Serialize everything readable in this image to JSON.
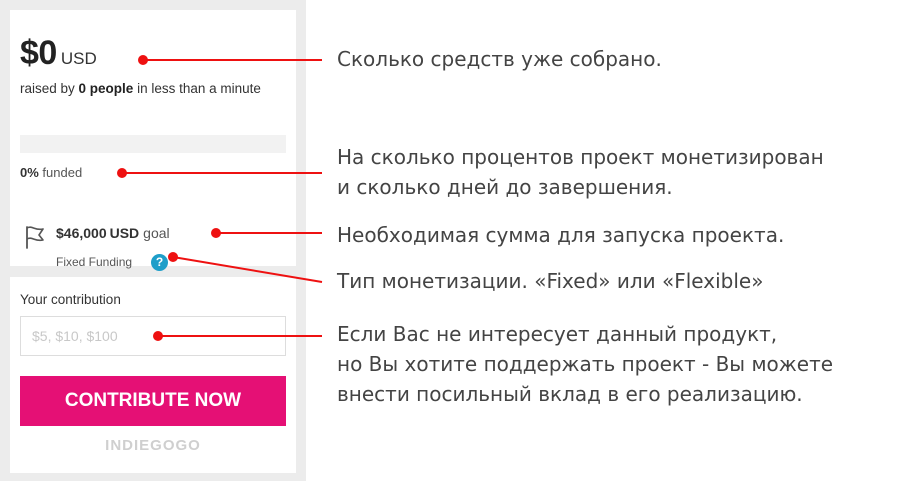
{
  "campaign": {
    "amount": "$0",
    "currency": "USD",
    "raised_prefix": "raised by",
    "raised_people": "0 people",
    "raised_suffix": "in less than a minute",
    "progress_fraction": 0,
    "funded_percent": "0%",
    "funded_word": "funded",
    "goal_amount": "$46,000",
    "goal_currency": "USD",
    "goal_word": "goal",
    "funding_type": "Fixed Funding",
    "help_glyph": "?"
  },
  "contribution": {
    "label": "Your contribution",
    "placeholder": "$5, $10, $100",
    "button_label": "CONTRIBUTE NOW",
    "brand": "INDIEGOGO"
  },
  "annotations": {
    "raised": [
      "Сколько средств уже собрано."
    ],
    "funded": [
      "На сколько процентов проект монетизирован",
      "и сколько дней до завершения."
    ],
    "goal": [
      "Необходимая сумма для запуска проекта."
    ],
    "funding_type": [
      "Тип монетизации. «Fixed» или «Flexible»"
    ],
    "contribute": [
      "Если Вас не интересует данный продукт,",
      "но Вы хотите поддержать проект - Вы можете",
      "внести посильный вклад в его реализацию."
    ]
  },
  "colors": {
    "accent": "#e51075",
    "annotation_line": "#ee1111",
    "help_icon": "#1e9ec9",
    "panel_bg": "#ececec"
  },
  "icons": [
    "flag-icon",
    "help-icon"
  ]
}
